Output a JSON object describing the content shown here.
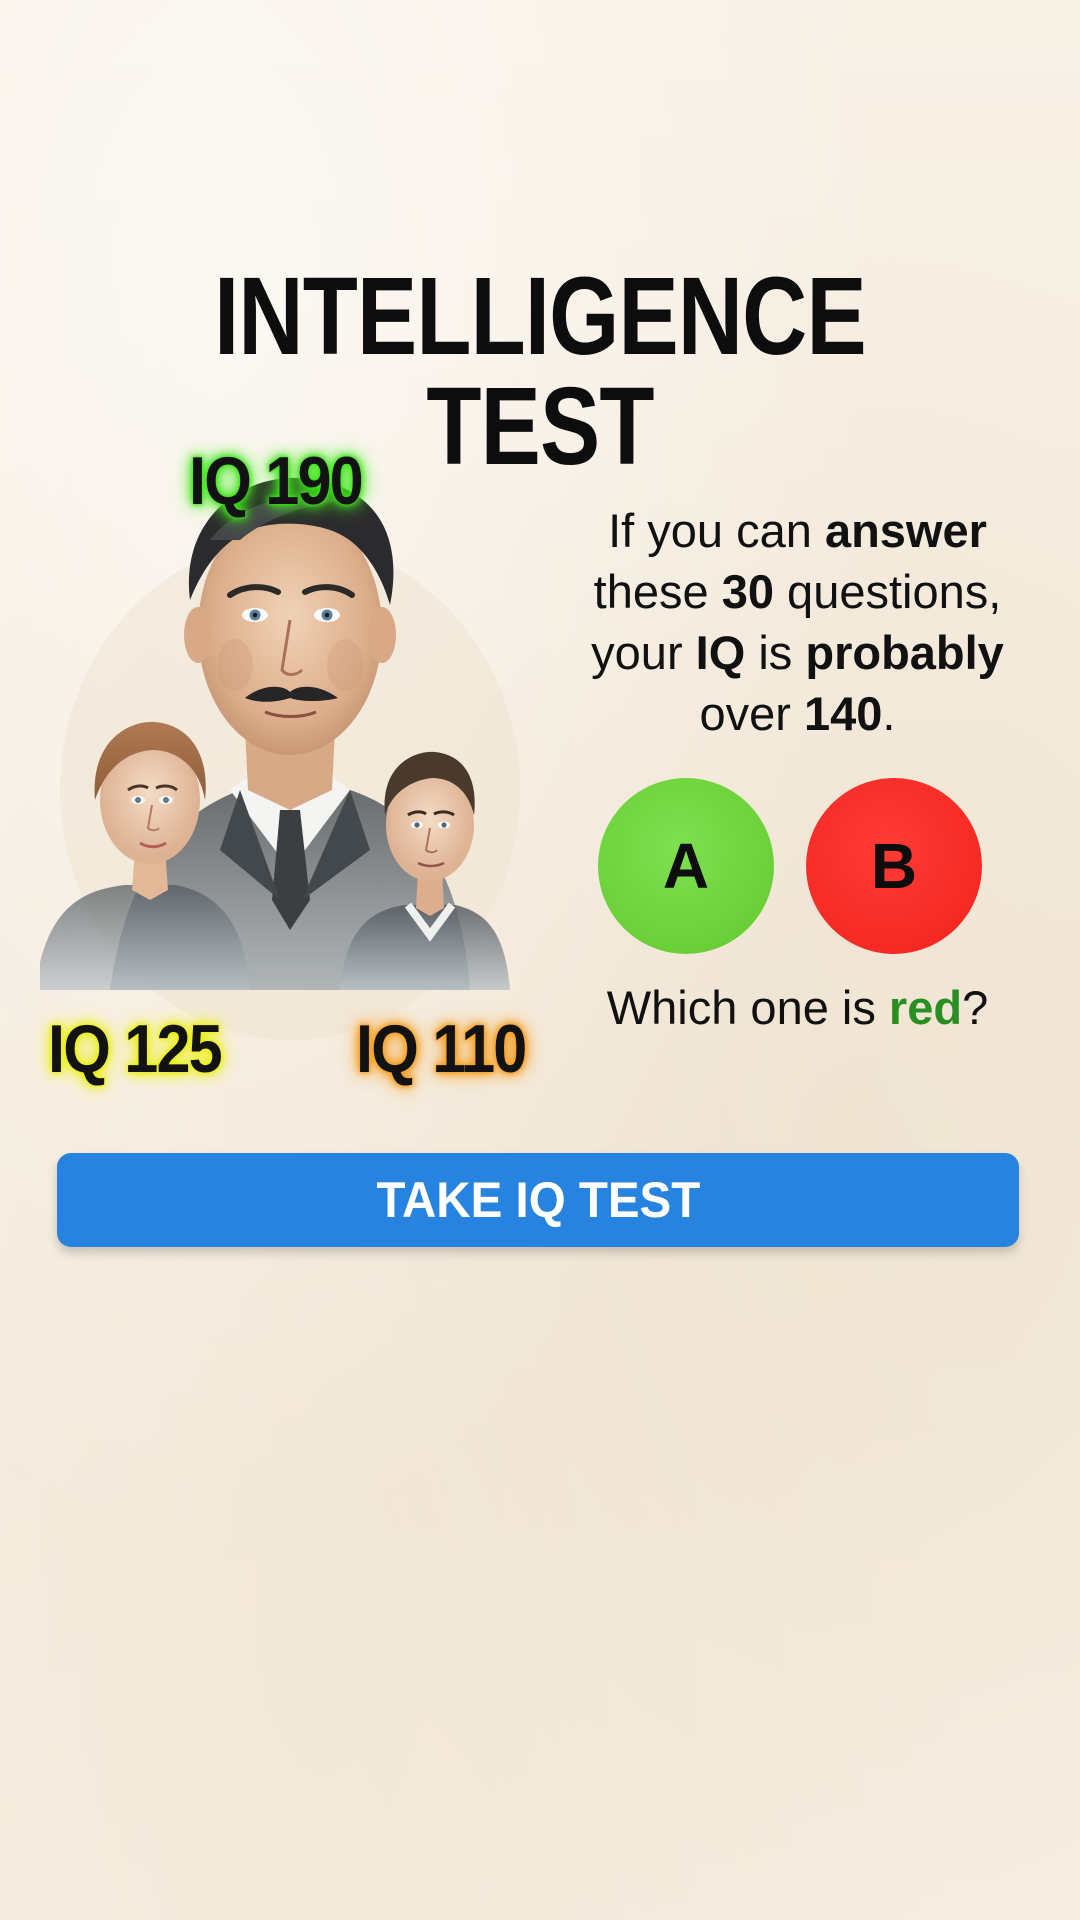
{
  "title": "INTELLIGENCE TEST",
  "portraits": {
    "top_label": "IQ 190",
    "left_label": "IQ 125",
    "right_label": "IQ 110"
  },
  "question": {
    "part1": "If you can ",
    "bold1": "answer",
    "part2": "these ",
    "bold2": "30",
    "part3": " questions,",
    "part4": "your ",
    "bold3": "IQ",
    "part5": " is ",
    "bold4": "probably",
    "part6": "over ",
    "bold5": "140",
    "part7": "."
  },
  "choices": {
    "a_label": "A",
    "b_label": "B"
  },
  "prompt": {
    "prefix": "Which one is ",
    "highlight": "red",
    "suffix": "?"
  },
  "cta_label": "TAKE IQ TEST",
  "colors": {
    "choice_a": "#6bd038",
    "choice_b": "#f52a24",
    "cta": "#2683e0",
    "highlight_word": "#2a8f22"
  },
  "icons": [
    "portrait-illustration-man-mustache",
    "portrait-illustration-woman",
    "portrait-illustration-man"
  ]
}
